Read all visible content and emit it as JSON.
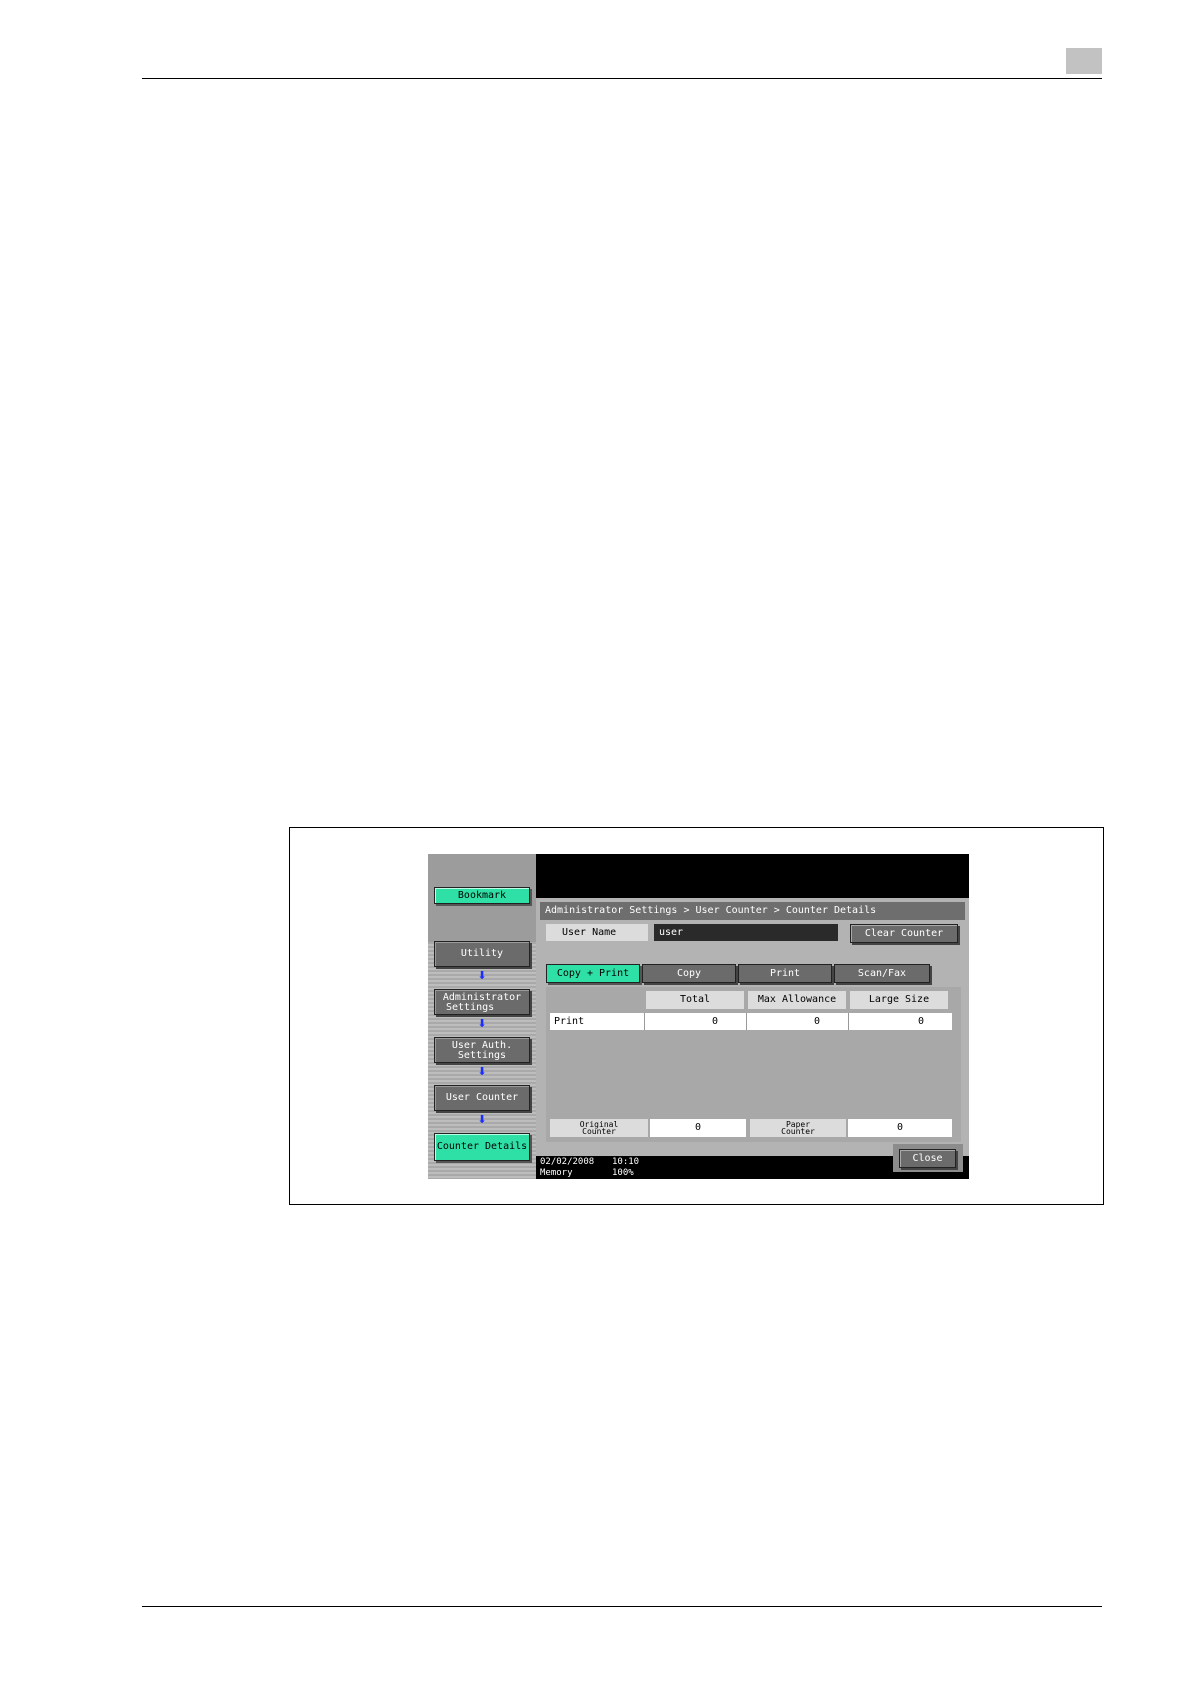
{
  "screen": {
    "sidebar": {
      "bookmark_label": "Bookmark",
      "items": [
        {
          "label": "Utility"
        },
        {
          "label_line1": "Administrator",
          "label_line2": "Settings"
        },
        {
          "label_line1": "User Auth.",
          "label_line2": "Settings"
        },
        {
          "label": "User Counter"
        },
        {
          "label": "Counter Details"
        }
      ],
      "arrow_glyph": "⬇"
    },
    "breadcrumb": "Administrator Settings > User Counter > Counter Details",
    "user_name_label": "User Name",
    "user_name_value": "user",
    "clear_counter_label": "Clear Counter",
    "tabs": [
      {
        "label": "Copy + Print",
        "active": true
      },
      {
        "label": "Copy",
        "active": false
      },
      {
        "label": "Print",
        "active": false
      },
      {
        "label": "Scan/Fax",
        "active": false
      }
    ],
    "table": {
      "columns": [
        "Total",
        "Max Allowance",
        "Large Size"
      ],
      "rows": [
        {
          "label": "Print",
          "values": [
            "0",
            "0",
            "0"
          ]
        }
      ]
    },
    "footer_counters": {
      "original_label_line1": "Original",
      "original_label_line2": "Counter",
      "original_value": "0",
      "paper_label_line1": "Paper",
      "paper_label_line2": "Counter",
      "paper_value": "0"
    },
    "status": {
      "date": "02/02/2008",
      "time": "10:10",
      "memory_label": "Memory",
      "memory_value": "100%"
    },
    "close_label": "Close"
  },
  "colors": {
    "accent_green": "#2fe0a6",
    "button_gray": "#6b6b6b",
    "arrow_blue": "#1a2fff"
  }
}
